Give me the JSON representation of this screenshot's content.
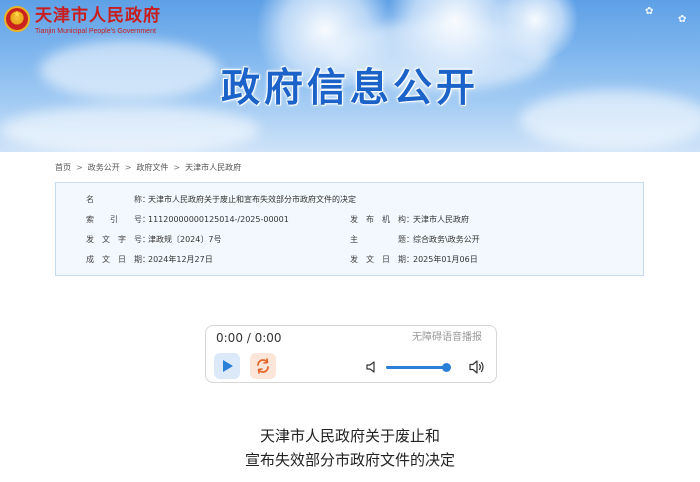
{
  "header": {
    "site_title": "天津市人民政府",
    "site_subtitle": "Tianjin Municipal People's Government",
    "page_heading": "政府信息公开"
  },
  "breadcrumb": {
    "items": [
      "首页",
      "政务公开",
      "政府文件",
      "天津市人民政府"
    ],
    "separator": ">"
  },
  "info": {
    "name_label": "名称",
    "name_value": "天津市人民政府关于废止和宣布失效部分市政府文件的决定",
    "index_label": "索引号",
    "index_value": "11120000000125014-/2025-00001",
    "issuer_label": "发布机构",
    "issuer_value": "天津市人民政府",
    "docno_label": "发文字号",
    "docno_value": "津政规〔2024〕7号",
    "topic_label": "主题",
    "topic_value": "综合政务\\政务公开",
    "created_label": "成文日期",
    "created_value": "2024年12月27日",
    "published_label": "发文日期",
    "published_value": "2025年01月06日",
    "colon": "："
  },
  "player": {
    "time": "0:00 / 0:00",
    "accessibility_label": "无障碍语音播报",
    "volume": 0.95
  },
  "document": {
    "title_line1": "天津市人民政府关于废止和",
    "title_line2": "宣布失效部分市政府文件的决定"
  },
  "colors": {
    "brand_red": "#c81e1e",
    "heading_blue": "#1b63c9",
    "accent_blue": "#2a7fd6",
    "info_bg": "#f3f8fe",
    "repeat_orange": "#e8662a"
  },
  "icons": {
    "logo": "national-emblem-icon",
    "play": "play-icon",
    "repeat": "repeat-icon",
    "volume_low": "volume-low-icon",
    "volume_high": "volume-high-icon"
  }
}
